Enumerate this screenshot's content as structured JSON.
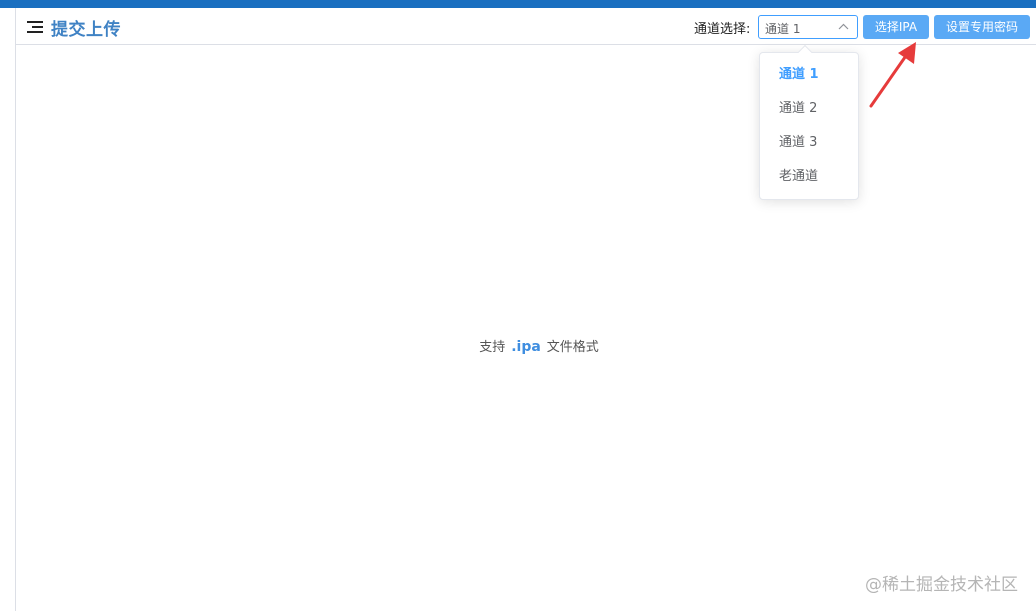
{
  "header": {
    "title": "提交上传",
    "menu_icon": "hamburger-menu-icon",
    "channel_label": "通道选择:",
    "channel_selected": "通道 1",
    "select_ipa_label": "选择IPA",
    "set_password_label": "设置专用密码"
  },
  "dropdown": {
    "options": [
      {
        "label": "通道 1",
        "selected": true
      },
      {
        "label": "通道 2",
        "selected": false
      },
      {
        "label": "通道 3",
        "selected": false
      },
      {
        "label": "老通道",
        "selected": false
      }
    ]
  },
  "main": {
    "hint_prefix": "支持",
    "hint_ext": ".ipa",
    "hint_suffix": "文件格式"
  },
  "watermark": "@稀土掘金技术社区",
  "colors": {
    "top_strip": "#1a6fc0",
    "title": "#3f82c4",
    "button": "#5aa9f5",
    "accent": "#409eff",
    "annotation_arrow": "#e63b3b"
  }
}
